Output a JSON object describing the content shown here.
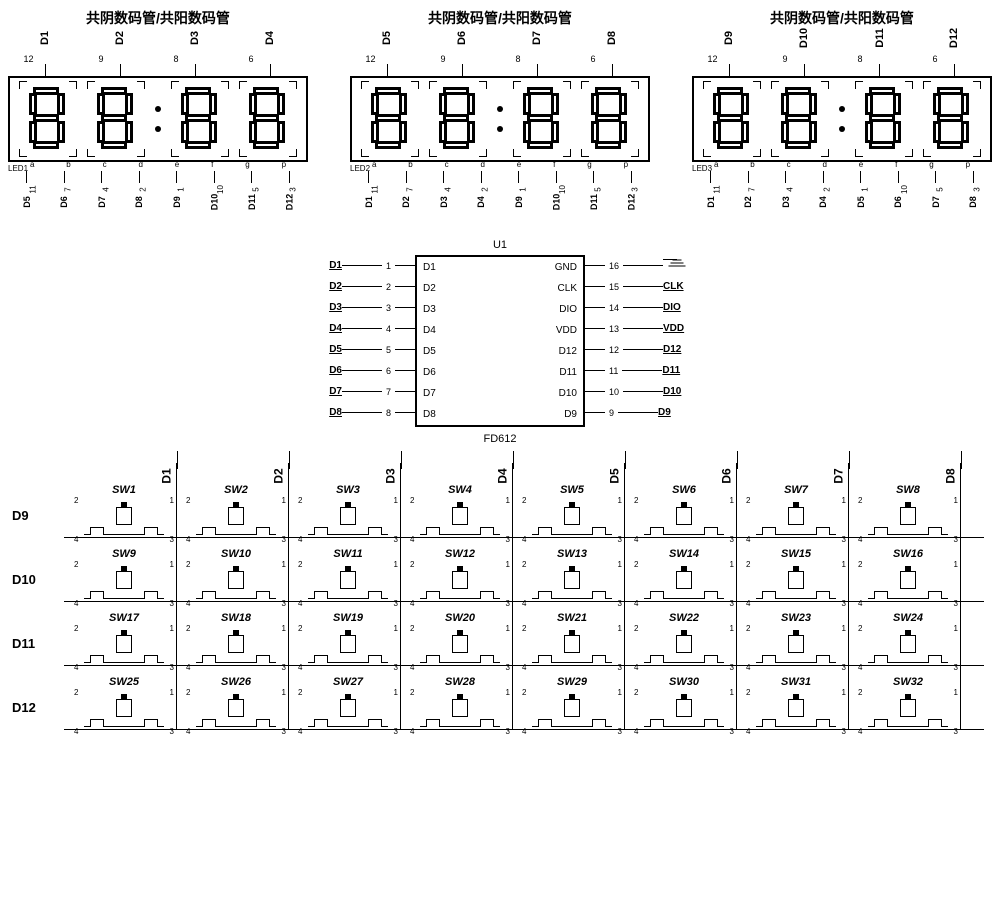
{
  "displays": [
    {
      "title": "共阴数码管/共阳数码管",
      "ref": "LED1",
      "top_pins": [
        {
          "net": "D1",
          "num": "12"
        },
        {
          "net": "D2",
          "num": "9"
        },
        {
          "net": "D3",
          "num": "8"
        },
        {
          "net": "D4",
          "num": "6"
        }
      ],
      "bot_pins": [
        {
          "net": "D5",
          "num": "11"
        },
        {
          "net": "D6",
          "num": "7"
        },
        {
          "net": "D7",
          "num": "4"
        },
        {
          "net": "D8",
          "num": "2"
        },
        {
          "net": "D9",
          "num": "1"
        },
        {
          "net": "D10",
          "num": "10"
        },
        {
          "net": "D11",
          "num": "5"
        },
        {
          "net": "D12",
          "num": "3"
        }
      ],
      "seg_letters": [
        "a",
        "b",
        "c",
        "d",
        "e",
        "f",
        "g",
        "p"
      ]
    },
    {
      "title": "共阴数码管/共阳数码管",
      "ref": "LED2",
      "top_pins": [
        {
          "net": "D5",
          "num": "12"
        },
        {
          "net": "D6",
          "num": "9"
        },
        {
          "net": "D7",
          "num": "8"
        },
        {
          "net": "D8",
          "num": "6"
        }
      ],
      "bot_pins": [
        {
          "net": "D1",
          "num": "11"
        },
        {
          "net": "D2",
          "num": "7"
        },
        {
          "net": "D3",
          "num": "4"
        },
        {
          "net": "D4",
          "num": "2"
        },
        {
          "net": "D9",
          "num": "1"
        },
        {
          "net": "D10",
          "num": "10"
        },
        {
          "net": "D11",
          "num": "5"
        },
        {
          "net": "D12",
          "num": "3"
        }
      ],
      "seg_letters": [
        "a",
        "b",
        "c",
        "d",
        "e",
        "f",
        "g",
        "p"
      ]
    },
    {
      "title": "共阴数码管/共阳数码管",
      "ref": "LED3",
      "top_pins": [
        {
          "net": "D9",
          "num": "12"
        },
        {
          "net": "D10",
          "num": "9"
        },
        {
          "net": "D11",
          "num": "8"
        },
        {
          "net": "D12",
          "num": "6"
        }
      ],
      "bot_pins": [
        {
          "net": "D1",
          "num": "11"
        },
        {
          "net": "D2",
          "num": "7"
        },
        {
          "net": "D3",
          "num": "4"
        },
        {
          "net": "D4",
          "num": "2"
        },
        {
          "net": "D5",
          "num": "1"
        },
        {
          "net": "D6",
          "num": "10"
        },
        {
          "net": "D7",
          "num": "5"
        },
        {
          "net": "D8",
          "num": "3"
        }
      ],
      "seg_letters": [
        "a",
        "b",
        "c",
        "d",
        "e",
        "f",
        "g",
        "p"
      ]
    }
  ],
  "ic": {
    "ref": "U1",
    "part": "FD612",
    "left": [
      {
        "net": "D1",
        "num": "1",
        "pin": "D1"
      },
      {
        "net": "D2",
        "num": "2",
        "pin": "D2"
      },
      {
        "net": "D3",
        "num": "3",
        "pin": "D3"
      },
      {
        "net": "D4",
        "num": "4",
        "pin": "D4"
      },
      {
        "net": "D5",
        "num": "5",
        "pin": "D5"
      },
      {
        "net": "D6",
        "num": "6",
        "pin": "D6"
      },
      {
        "net": "D7",
        "num": "7",
        "pin": "D7"
      },
      {
        "net": "D8",
        "num": "8",
        "pin": "D8"
      }
    ],
    "right": [
      {
        "pin": "GND",
        "num": "16",
        "net": "GND_SYM"
      },
      {
        "pin": "CLK",
        "num": "15",
        "net": "CLK"
      },
      {
        "pin": "DIO",
        "num": "14",
        "net": "DIO"
      },
      {
        "pin": "VDD",
        "num": "13",
        "net": "VDD"
      },
      {
        "pin": "D12",
        "num": "12",
        "net": "D12"
      },
      {
        "pin": "D11",
        "num": "11",
        "net": "D11"
      },
      {
        "pin": "D10",
        "num": "10",
        "net": "D10"
      },
      {
        "pin": "D9",
        "num": "9",
        "net": "D9"
      }
    ]
  },
  "matrix": {
    "cols": [
      "D1",
      "D2",
      "D3",
      "D4",
      "D5",
      "D6",
      "D7",
      "D8"
    ],
    "rows": [
      "D9",
      "D10",
      "D11",
      "D12"
    ],
    "switches": [
      [
        "SW1",
        "SW2",
        "SW3",
        "SW4",
        "SW5",
        "SW6",
        "SW7",
        "SW8"
      ],
      [
        "SW9",
        "SW10",
        "SW11",
        "SW12",
        "SW13",
        "SW14",
        "SW15",
        "SW16"
      ],
      [
        "SW17",
        "SW18",
        "SW19",
        "SW20",
        "SW21",
        "SW22",
        "SW23",
        "SW24"
      ],
      [
        "SW25",
        "SW26",
        "SW27",
        "SW28",
        "SW29",
        "SW30",
        "SW31",
        "SW32"
      ]
    ],
    "pad_top": {
      "left": "2",
      "right": "1"
    },
    "pad_bot": {
      "left": "4",
      "right": "3"
    }
  }
}
